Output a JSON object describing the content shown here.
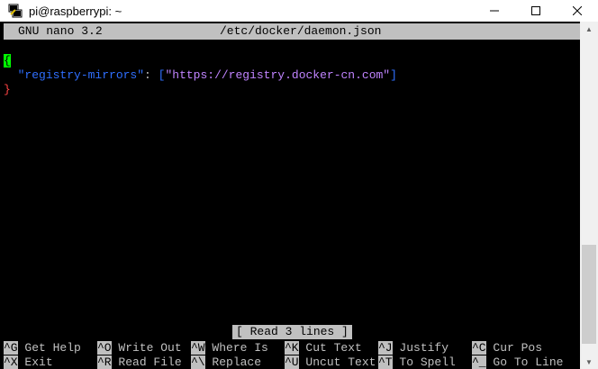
{
  "window": {
    "title": "pi@raspberrypi: ~"
  },
  "nano": {
    "version": "GNU nano 3.2",
    "filename": "/etc/docker/daemon.json",
    "status": "[ Read 3 lines ]"
  },
  "content": {
    "line1": "{",
    "line2_key": "\"registry-mirrors\"",
    "line2_colon": ": ",
    "line2_val_open": "[",
    "line2_val": "\"https://registry.docker-cn.com\"",
    "line2_val_close": "]",
    "line3": "}"
  },
  "shortcuts_row1": [
    {
      "key": "^G",
      "label": " Get Help"
    },
    {
      "key": "^O",
      "label": " Write Out"
    },
    {
      "key": "^W",
      "label": " Where Is"
    },
    {
      "key": "^K",
      "label": " Cut Text"
    },
    {
      "key": "^J",
      "label": " Justify"
    },
    {
      "key": "^C",
      "label": " Cur Pos"
    }
  ],
  "shortcuts_row2": [
    {
      "key": "^X",
      "label": " Exit"
    },
    {
      "key": "^R",
      "label": " Read File"
    },
    {
      "key": "^\\",
      "label": " Replace"
    },
    {
      "key": "^U",
      "label": " Uncut Text"
    },
    {
      "key": "^T",
      "label": " To Spell"
    },
    {
      "key": "^_",
      "label": " Go To Line"
    }
  ]
}
